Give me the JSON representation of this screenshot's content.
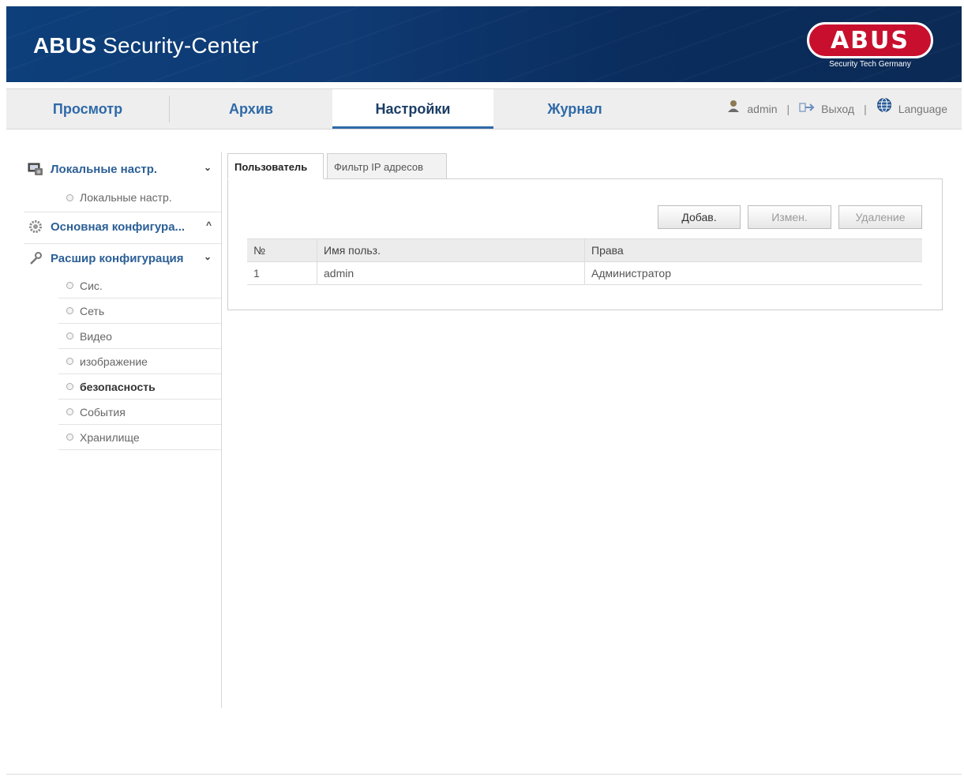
{
  "header": {
    "app_title_bold": "ABUS",
    "app_title_rest": " Security-Center",
    "logo_text": "ABUS",
    "logo_tagline": "Security Tech Germany",
    "brand_red": "#c8102e",
    "banner_blue": "#0f3a73"
  },
  "nav": {
    "tabs": [
      {
        "label": "Просмотр",
        "active": false
      },
      {
        "label": "Архив",
        "active": false
      },
      {
        "label": "Настройки",
        "active": true
      },
      {
        "label": "Журнал",
        "active": false
      }
    ],
    "user": {
      "username": "admin",
      "logout": "Выход",
      "language": "Language",
      "separator": "|",
      "user_icon": "user-icon",
      "logout_icon": "logout-arrow-icon",
      "language_icon": "globe-icon"
    }
  },
  "sidebar": {
    "groups": [
      {
        "label": "Локальные настр.",
        "icon": "monitor-icon",
        "chevron": "⌄",
        "items": [
          {
            "label": "Локальные настр.",
            "active": false
          }
        ]
      },
      {
        "label": "Основная конфигура...",
        "icon": "gear-icon",
        "chevron": "^",
        "items": []
      },
      {
        "label": "Расшир конфигурация",
        "icon": "wrench-icon",
        "chevron": "⌄",
        "items": [
          {
            "label": "Сис.",
            "active": false
          },
          {
            "label": "Сеть",
            "active": false
          },
          {
            "label": "Видео",
            "active": false
          },
          {
            "label": "изображение",
            "active": false
          },
          {
            "label": "безопасность",
            "active": true
          },
          {
            "label": "События",
            "active": false
          },
          {
            "label": "Хранилище",
            "active": false
          }
        ]
      }
    ]
  },
  "content": {
    "tabs": [
      {
        "label": "Пользователь",
        "active": true
      },
      {
        "label": "Фильтр IP адресов",
        "active": false
      }
    ],
    "buttons": {
      "add": "Добав.",
      "edit": "Измен.",
      "delete": "Удаление"
    },
    "table": {
      "headers": [
        "№",
        "Имя польз.",
        "Права"
      ],
      "rows": [
        [
          "1",
          "admin",
          "Администратор"
        ]
      ]
    }
  }
}
